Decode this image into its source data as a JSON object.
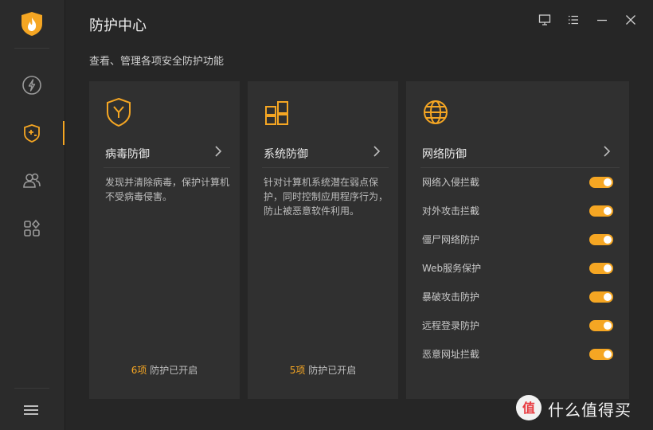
{
  "app": {
    "title": "防护中心",
    "subtitle": "查看、管理各项安全防护功能",
    "accent_color": "#f5a623"
  },
  "sidebar": {
    "items": [
      {
        "icon": "lightning-icon",
        "active": false
      },
      {
        "icon": "shield-plus-icon",
        "active": true
      },
      {
        "icon": "users-icon",
        "active": false
      },
      {
        "icon": "apps-icon",
        "active": false
      }
    ],
    "menu_icon": "hamburger-menu-icon"
  },
  "window_controls": [
    "feedback-icon",
    "settings-list-icon",
    "minimize-icon",
    "close-icon"
  ],
  "cards": [
    {
      "title": "病毒防御",
      "icon": "virus-shield-icon",
      "description": "发现并清除病毒，保护计算机不受病毒侵害。",
      "footer_count": "6项",
      "footer_text": "防护已开启"
    },
    {
      "title": "系统防御",
      "icon": "windows-grid-icon",
      "description": "针对计算机系统潜在弱点保护，同时控制应用程序行为，防止被恶意软件利用。",
      "footer_count": "5项",
      "footer_text": "防护已开启"
    },
    {
      "title": "网络防御",
      "icon": "globe-icon",
      "toggles": [
        {
          "label": "网络入侵拦截",
          "on": true
        },
        {
          "label": "对外攻击拦截",
          "on": true
        },
        {
          "label": "僵尸网络防护",
          "on": true
        },
        {
          "label": "Web服务保护",
          "on": true
        },
        {
          "label": "暴破攻击防护",
          "on": true
        },
        {
          "label": "远程登录防护",
          "on": true
        },
        {
          "label": "恶意网址拦截",
          "on": true
        }
      ]
    }
  ],
  "watermark": {
    "logo_char": "值",
    "text": "什么值得买"
  }
}
